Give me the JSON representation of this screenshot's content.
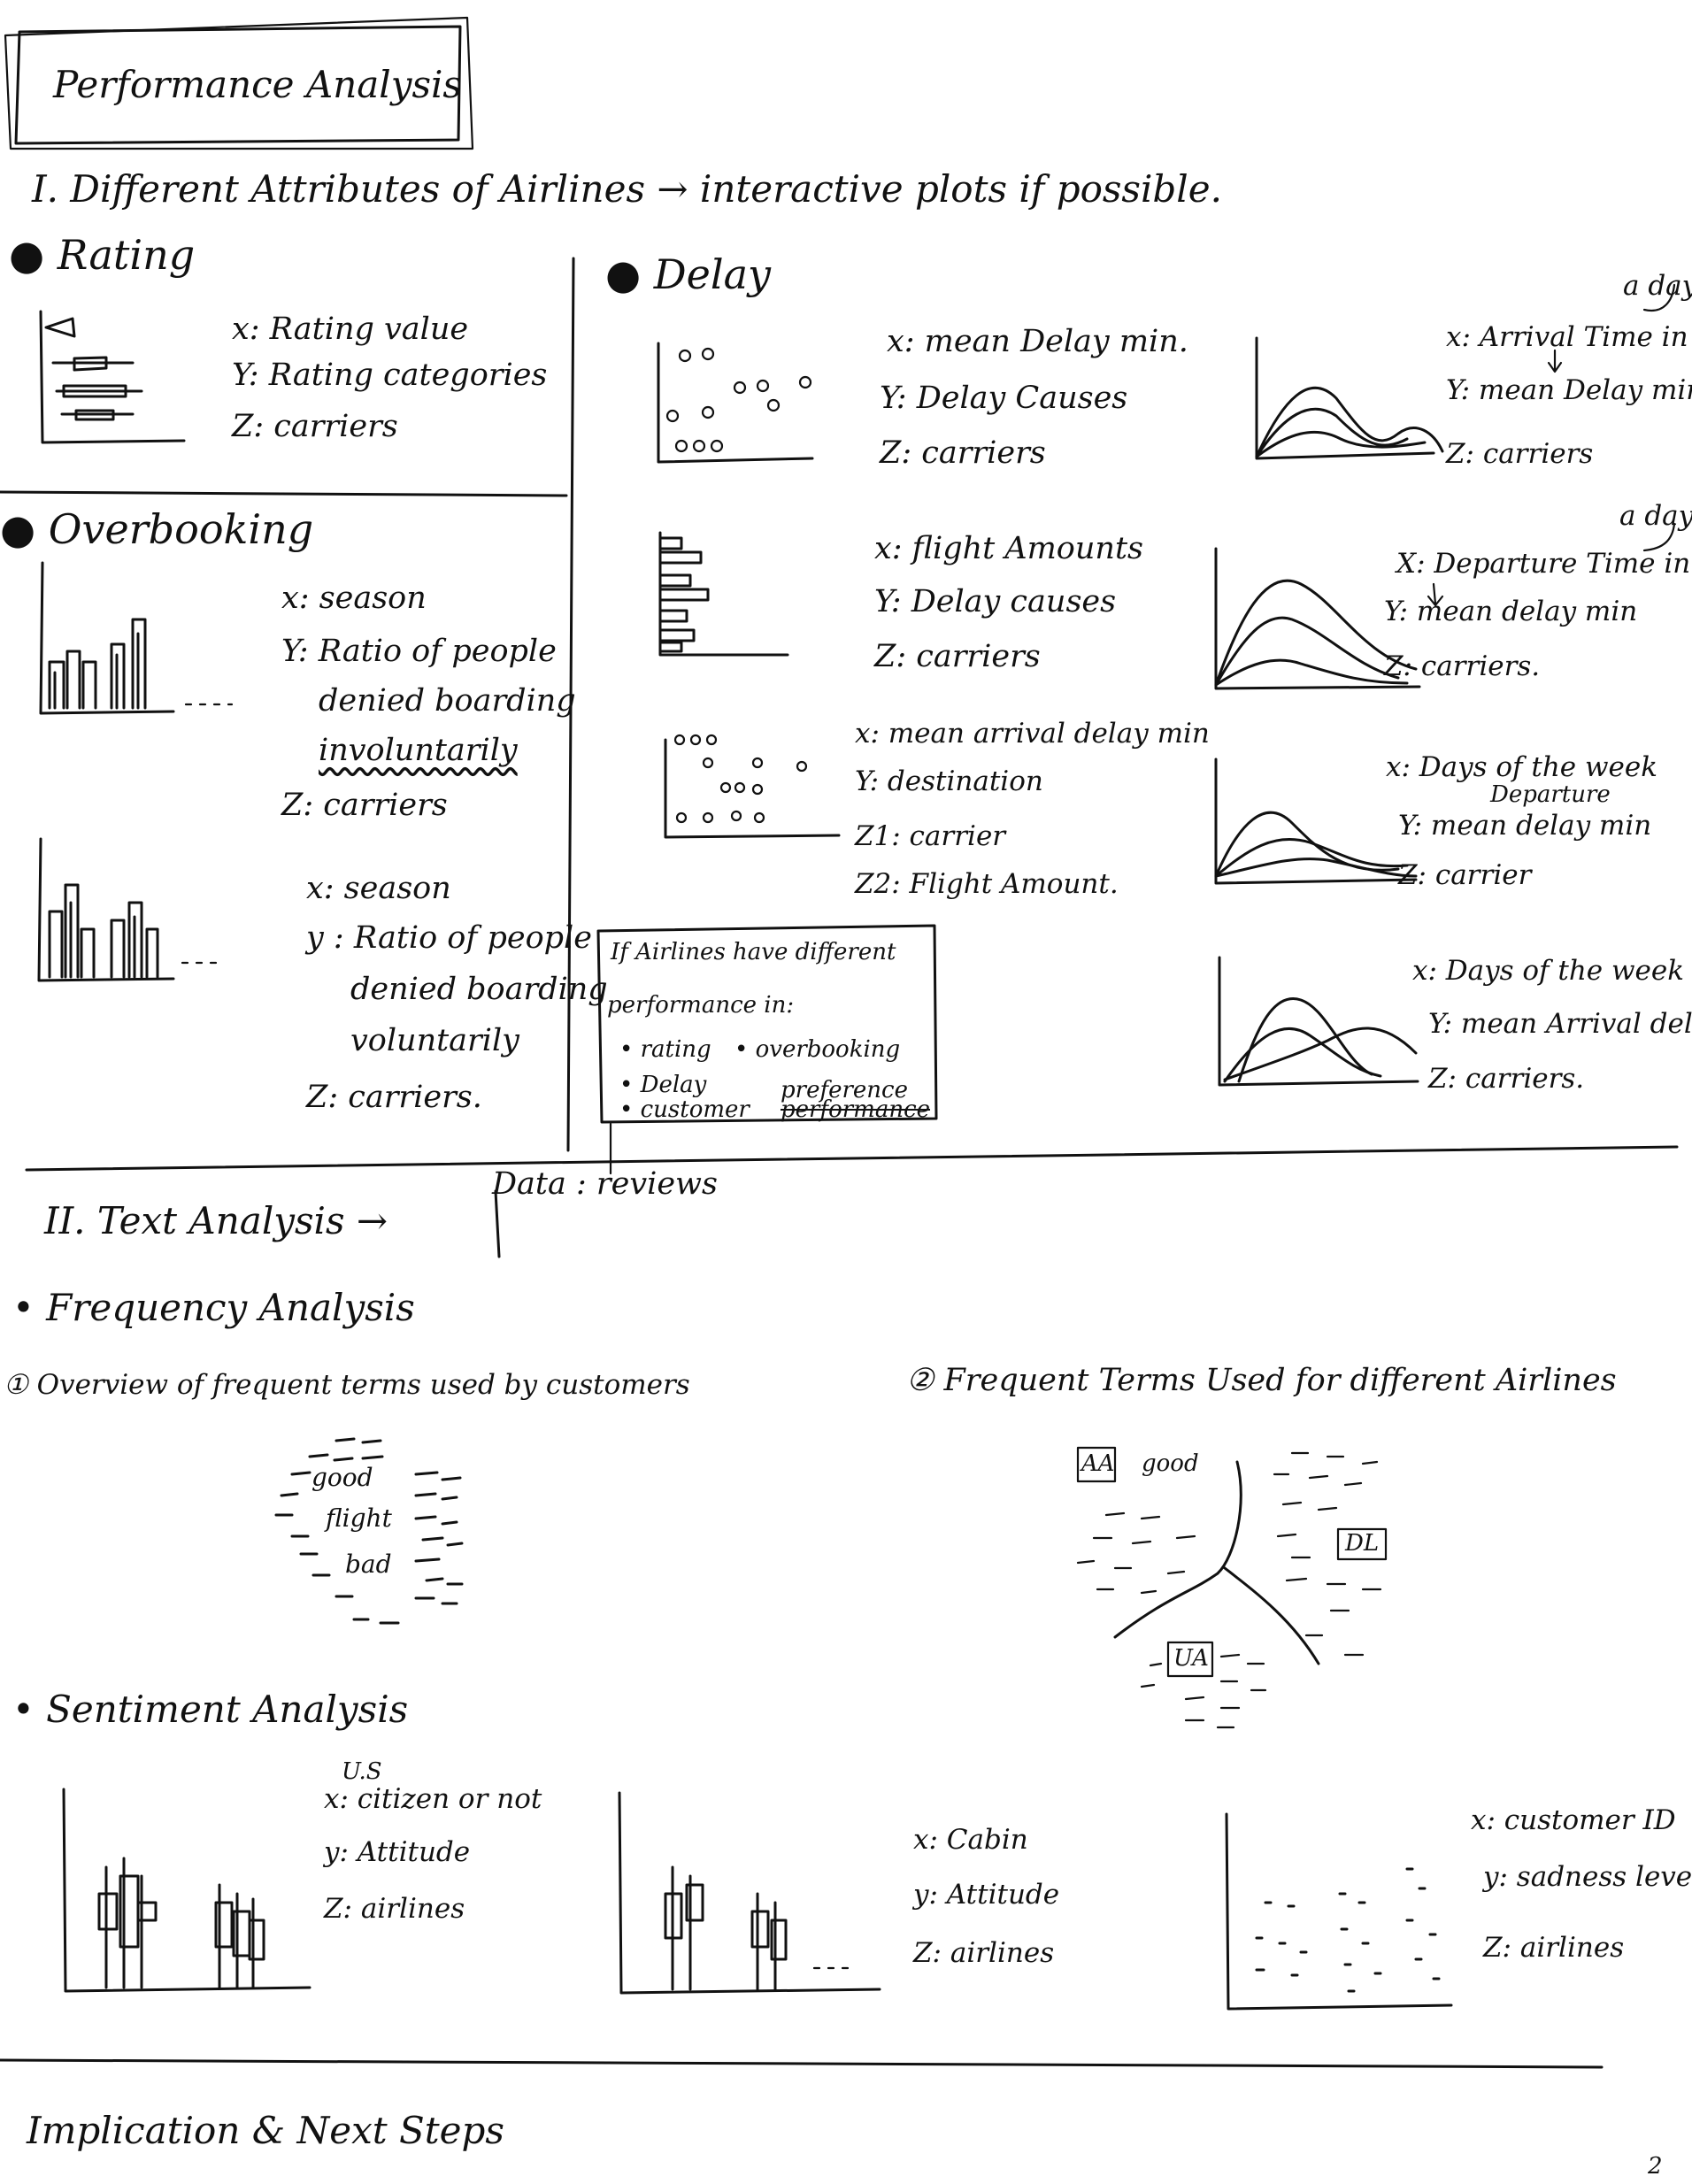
{
  "title": "Performance Analysis",
  "section1": {
    "heading": "I. Different Attributes of Airlines → interactive plots if possible.",
    "rating": {
      "heading": "Rating",
      "x": "x: Rating value",
      "y": "Y: Rating categories",
      "z": "Z: carriers"
    },
    "overbooking": {
      "heading": "Overbooking",
      "chart1": {
        "x": "x: season",
        "y1": "Y: Ratio of people",
        "y2": "denied boarding",
        "y3": "involuntarily",
        "z": "Z: carriers"
      },
      "chart2": {
        "x": "x: season",
        "y1": "y : Ratio of people",
        "y2": "denied boarding",
        "y3": "voluntarily",
        "z": "Z: carriers."
      }
    },
    "delay": {
      "heading": "Delay",
      "scatter1": {
        "x": "x: mean Delay min.",
        "y": "Y: Delay Causes",
        "z": "Z: carriers"
      },
      "hbar": {
        "x": "x: flight Amounts",
        "y": "Y: Delay causes",
        "z": "Z: carriers"
      },
      "scatter2": {
        "x": "x: mean arrival delay min",
        "y": "Y: destination",
        "z1": "Z1: carrier",
        "z2": "Z2: Flight Amount."
      },
      "line1": {
        "note": "a day",
        "x": "x: Arrival Time in",
        "y": "Y: mean Delay min",
        "z": "Z: carriers"
      },
      "line2": {
        "note": "a day",
        "x": "X: Departure Time in",
        "y": "Y: mean delay min",
        "z": "Z: carriers."
      },
      "line3": {
        "x": "x: Days of the week",
        "note": "Departure",
        "y": "Y: mean delay min",
        "z": "Z: carrier"
      },
      "line4": {
        "x": "x: Days of the week",
        "y": "Y: mean Arrival delay",
        "z": "Z: carriers."
      }
    },
    "box": {
      "line1": "If Airlines have different",
      "line2": "performance in:",
      "item1": "• rating",
      "item2": "• overbooking",
      "item3": "• Delay",
      "item4": "• customer",
      "item4a": "preference",
      "item4b": "performance"
    }
  },
  "section2": {
    "heading": "II. Text Analysis →",
    "data_note": "Data : reviews",
    "frequency": {
      "heading": "• Frequency Analysis",
      "overview": "① Overview of frequent terms used by customers",
      "per_airline": "② Frequent Terms Used for different Airlines",
      "cloud_words": [
        "good",
        "flight",
        "bad"
      ],
      "airline_labels": [
        "AA",
        "DL",
        "UA"
      ],
      "airline_word": "good"
    },
    "sentiment": {
      "heading": "• Sentiment Analysis",
      "plot1": {
        "note": "U.S",
        "x": "x: citizen or not",
        "y": "y: Attitude",
        "z": "Z: airlines"
      },
      "plot2": {
        "x": "x: Cabin",
        "y": "y: Attitude",
        "z": "Z: airlines"
      },
      "plot3": {
        "x": "x: customer ID",
        "y": "y: sadness level",
        "z": "Z: airlines"
      }
    }
  },
  "section3": {
    "heading": "Implication & Next Steps",
    "page_number": "2"
  }
}
